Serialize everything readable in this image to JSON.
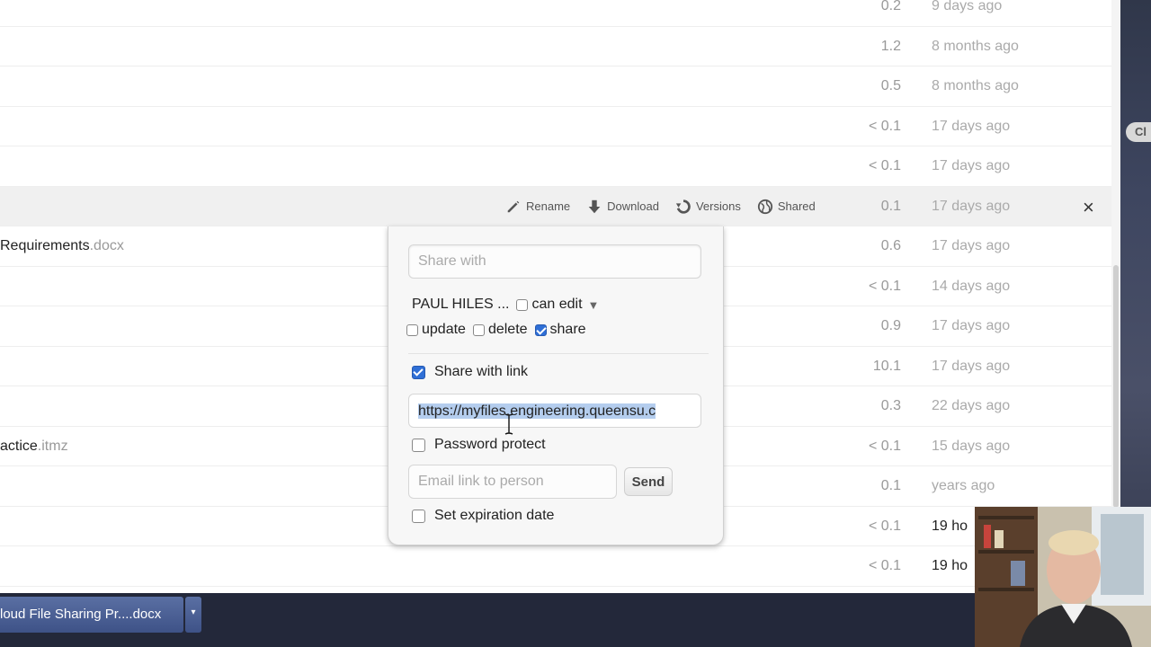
{
  "file_rows": [
    {
      "name": "",
      "ext": "",
      "size": "0.2",
      "modified": "9 days ago",
      "recent": false
    },
    {
      "name": "",
      "ext": "",
      "size": "1.2",
      "modified": "8 months ago",
      "recent": false
    },
    {
      "name": "",
      "ext": "",
      "size": "0.5",
      "modified": "8 months ago",
      "recent": false
    },
    {
      "name": "",
      "ext": "",
      "size": "< 0.1",
      "modified": "17 days ago",
      "recent": false
    },
    {
      "name": "",
      "ext": "",
      "size": "< 0.1",
      "modified": "17 days ago",
      "recent": false
    },
    {
      "name": "",
      "ext": "",
      "size": "0.1",
      "modified": "17 days ago",
      "recent": false,
      "hover": true
    },
    {
      "name": "Requirements",
      "ext": ".docx",
      "size": "0.6",
      "modified": "17 days ago",
      "recent": false
    },
    {
      "name": "",
      "ext": "",
      "size": "< 0.1",
      "modified": "14 days ago",
      "recent": false
    },
    {
      "name": "",
      "ext": "",
      "size": "0.9",
      "modified": "17 days ago",
      "recent": false
    },
    {
      "name": "",
      "ext": "",
      "size": "10.1",
      "modified": "17 days ago",
      "recent": false
    },
    {
      "name": "",
      "ext": "",
      "size": "0.3",
      "modified": "22 days ago",
      "recent": false
    },
    {
      "name": "actice",
      "ext": ".itmz",
      "size": "< 0.1",
      "modified": "15 days ago",
      "recent": false
    },
    {
      "name": "",
      "ext": "",
      "size": "0.1",
      "modified": "years ago",
      "recent": false
    },
    {
      "name": "",
      "ext": "",
      "size": "< 0.1",
      "modified": "19 ho",
      "recent": true
    },
    {
      "name": "",
      "ext": "",
      "size": "< 0.1",
      "modified": "19 ho",
      "recent": true
    }
  ],
  "row_actions": {
    "rename": "Rename",
    "download": "Download",
    "versions": "Versions",
    "shared": "Shared",
    "close": "×"
  },
  "share": {
    "share_with_placeholder": "Share with",
    "user_name": "PAUL HILES ...",
    "can_edit_label": "can edit",
    "can_edit_checked": false,
    "caret": "▼",
    "update_label": "update",
    "update_checked": false,
    "delete_label": "delete",
    "delete_checked": false,
    "share_label": "share",
    "share_checked": true,
    "share_with_link_label": "Share with link",
    "share_with_link_checked": true,
    "link_url": "https://myfiles.engineering.queensu.c",
    "password_protect_label": "Password protect",
    "password_protect_checked": false,
    "email_placeholder": "Email link to person",
    "send_label": "Send",
    "expiration_label": "Set expiration date",
    "expiration_checked": false
  },
  "download_bar": {
    "item_label": "loud File Sharing Pr....docx",
    "menu_glyph": "▾"
  },
  "desktop": {
    "chip_label": "Cl"
  },
  "colors": {
    "accent": "#2f6fd6",
    "selection": "#b4cdee",
    "download_bar": "#23283a"
  }
}
